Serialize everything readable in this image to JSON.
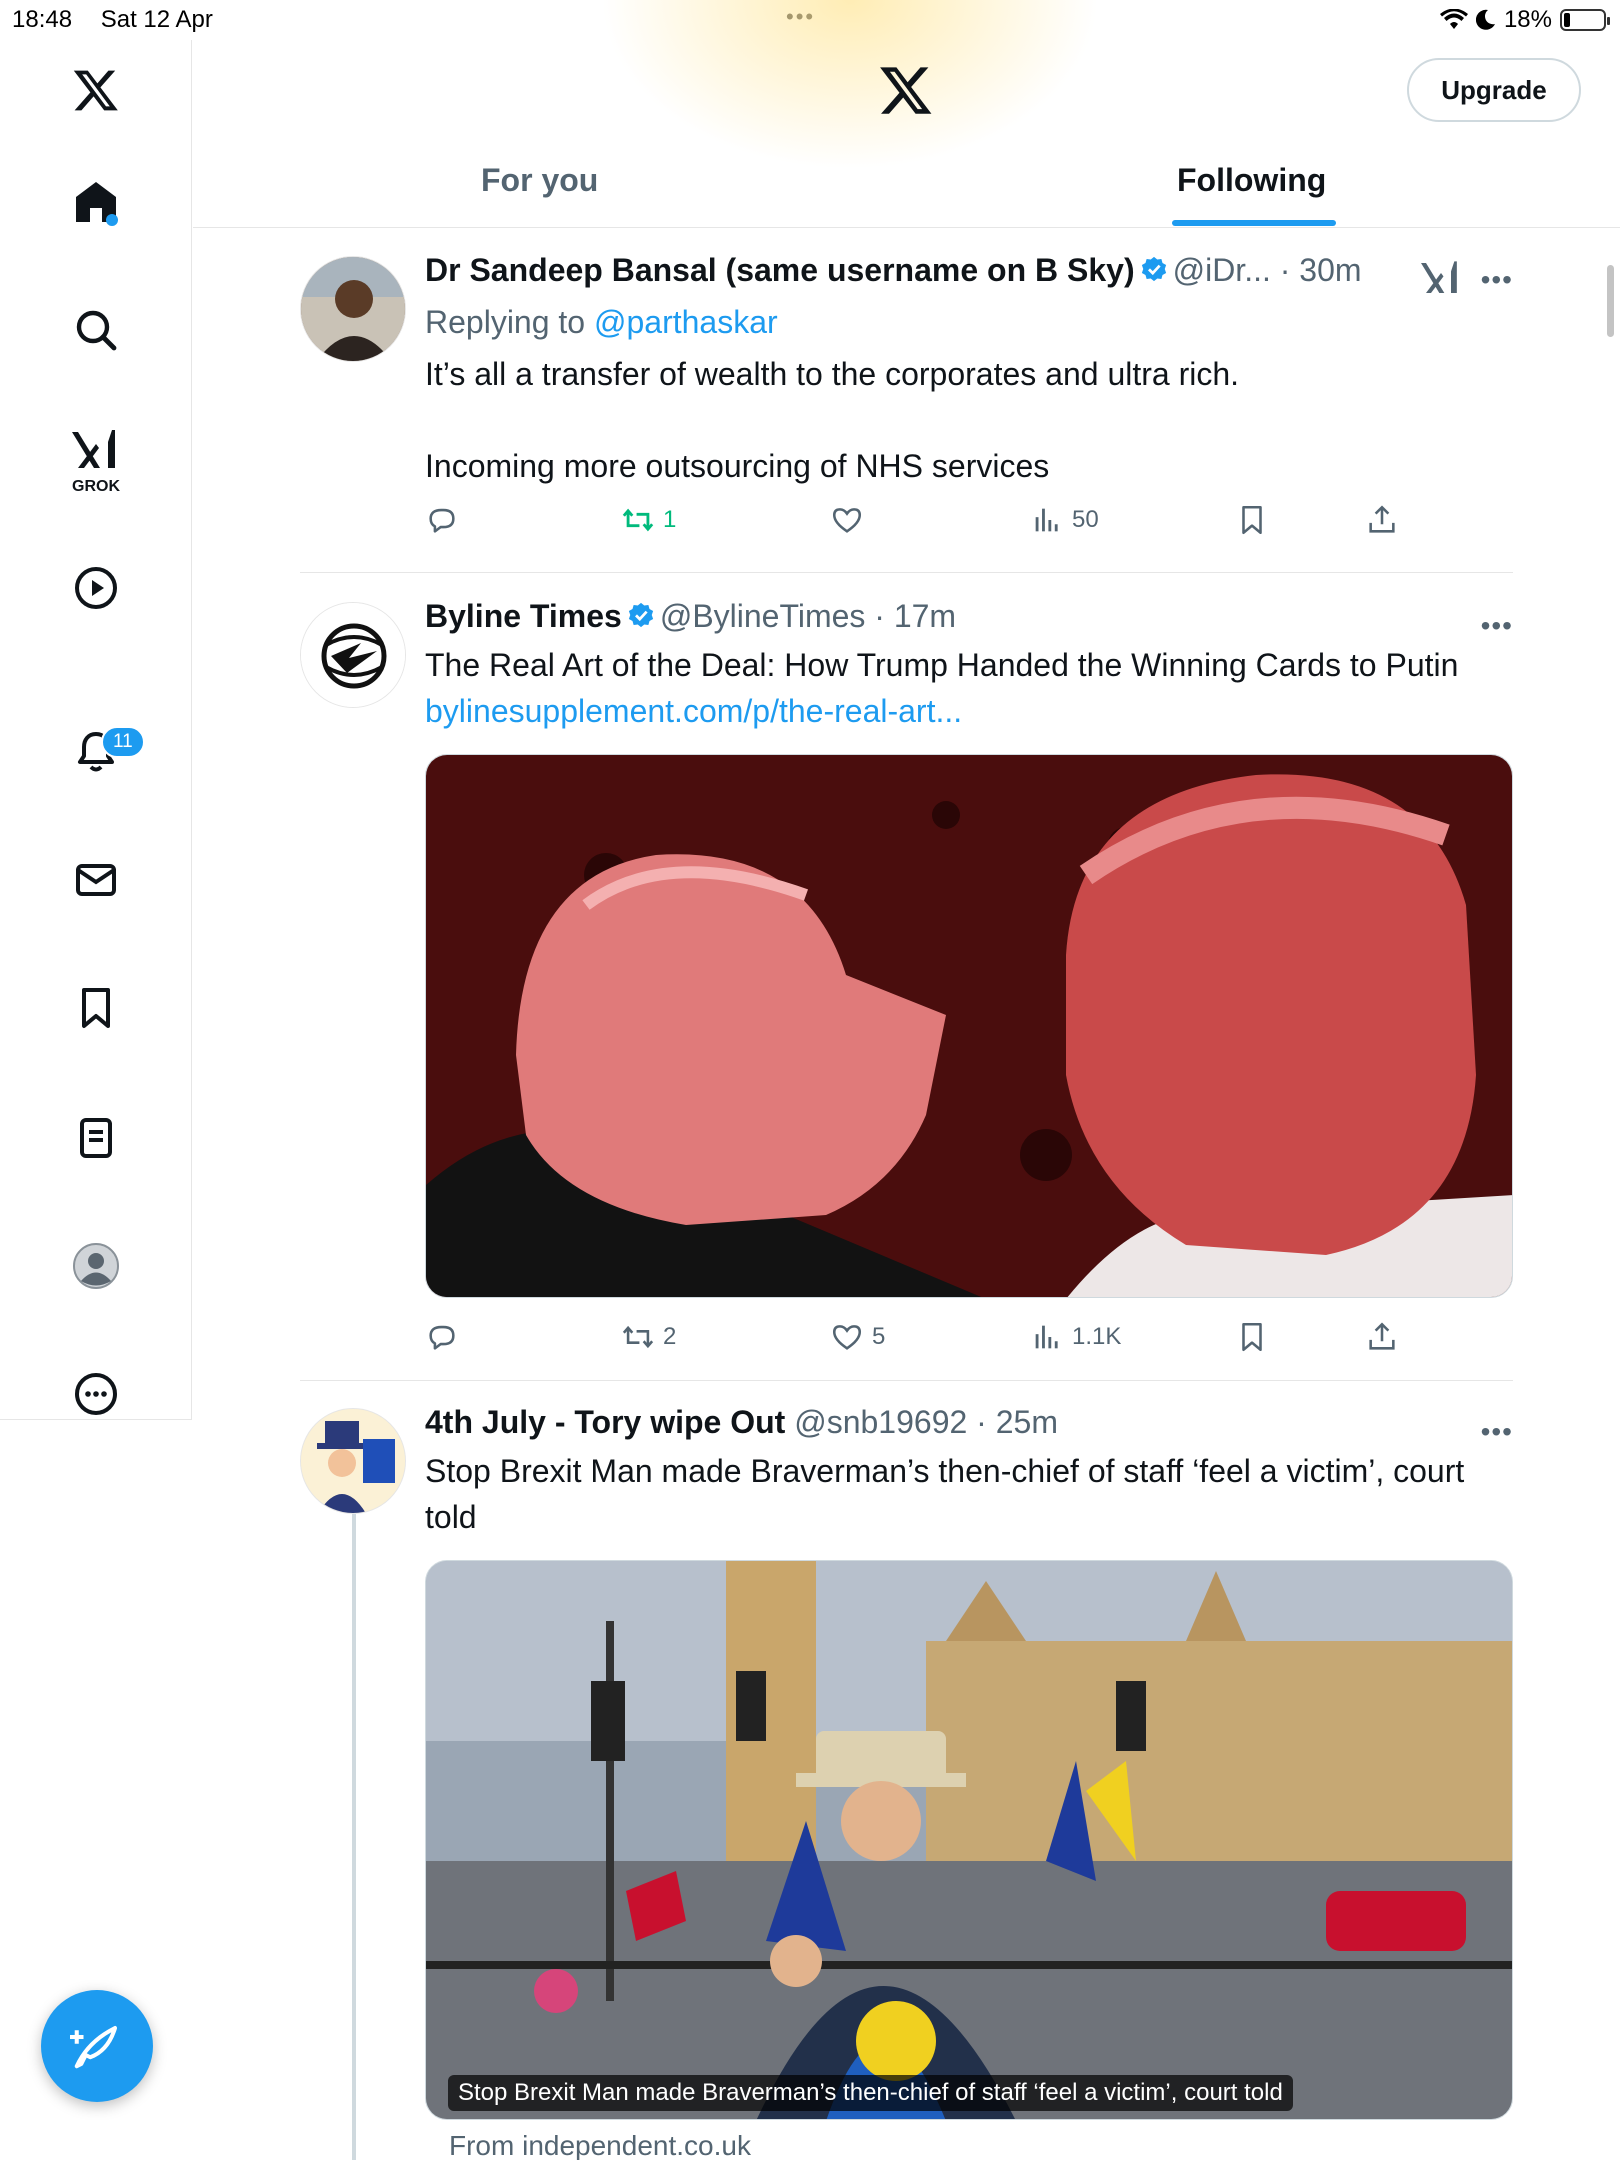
{
  "status_bar": {
    "time": "18:48",
    "date": "Sat 12 Apr",
    "battery": "18%"
  },
  "sidebar": {
    "grok_label": "GROK",
    "notifications_badge": "11"
  },
  "header": {
    "upgrade_label": "Upgrade"
  },
  "tabs": [
    {
      "label": "For you",
      "active": false
    },
    {
      "label": "Following",
      "active": true
    }
  ],
  "tweets": [
    {
      "name": "Dr Sandeep Bansal (same username on B Sky)",
      "handle": "@iDr...",
      "time": "30m",
      "replying_prefix": "Replying to",
      "replying_to": "@parthaskar",
      "text_line1": "It’s all a transfer of wealth to the corporates and ultra rich.",
      "text_line2": "Incoming more outsourcing of NHS services",
      "retweets": "1",
      "likes": "",
      "views": "50"
    },
    {
      "name": "Byline Times",
      "handle": "@BylineTimes",
      "time": "17m",
      "text": "The Real Art of the Deal: How Trump Handed the Winning Cards to Putin",
      "link": "bylinesupplement.com/p/the-real-art...",
      "retweets": "2",
      "likes": "5",
      "views": "1.1K"
    },
    {
      "name": "4th July - Tory wipe Out",
      "handle": "@snb19692",
      "time": "25m",
      "text": "Stop Brexit Man made Braverman’s then-chief of staff ‘feel a victim’, court told",
      "media_caption": "Stop Brexit Man made Braverman’s then-chief of staff ‘feel a victim’, court told",
      "from": "From independent.co.uk"
    }
  ],
  "colors": {
    "accent": "#1d9bf0",
    "retweet_green": "#00ba7c",
    "muted": "#536471"
  }
}
